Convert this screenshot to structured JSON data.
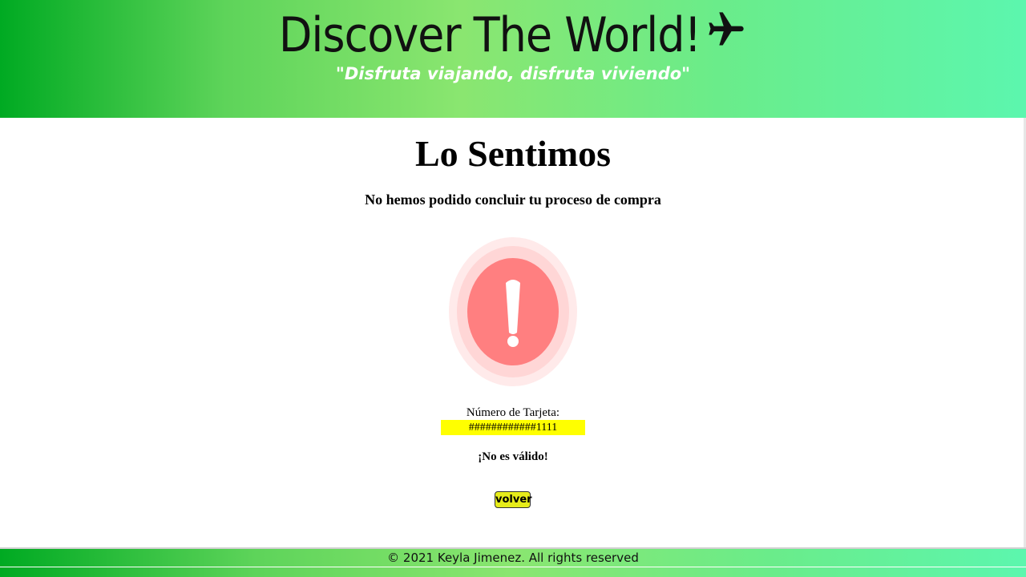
{
  "header": {
    "title": "Discover The World!",
    "tagline": "\"Disfruta viajando, disfruta viviendo\""
  },
  "main": {
    "title": "Lo Sentimos",
    "subtitle": "No hemos podido concluir tu proceso de compra",
    "alert_icon": "exclamation-alert-icon",
    "card_label": "Número de Tarjeta:",
    "card_number": "############1111",
    "invalid_message": "¡No es válido!",
    "back_button_label": "volver"
  },
  "footer": {
    "copyright": "© 2021 Keyla Jimenez. All rights reserved"
  },
  "colors": {
    "header_gradient_start": "#00aa22",
    "header_gradient_end": "#5cf6ae",
    "alert_red": "#ff7f80",
    "card_highlight": "#ffff00",
    "button_yellow": "#e6ec1a"
  }
}
